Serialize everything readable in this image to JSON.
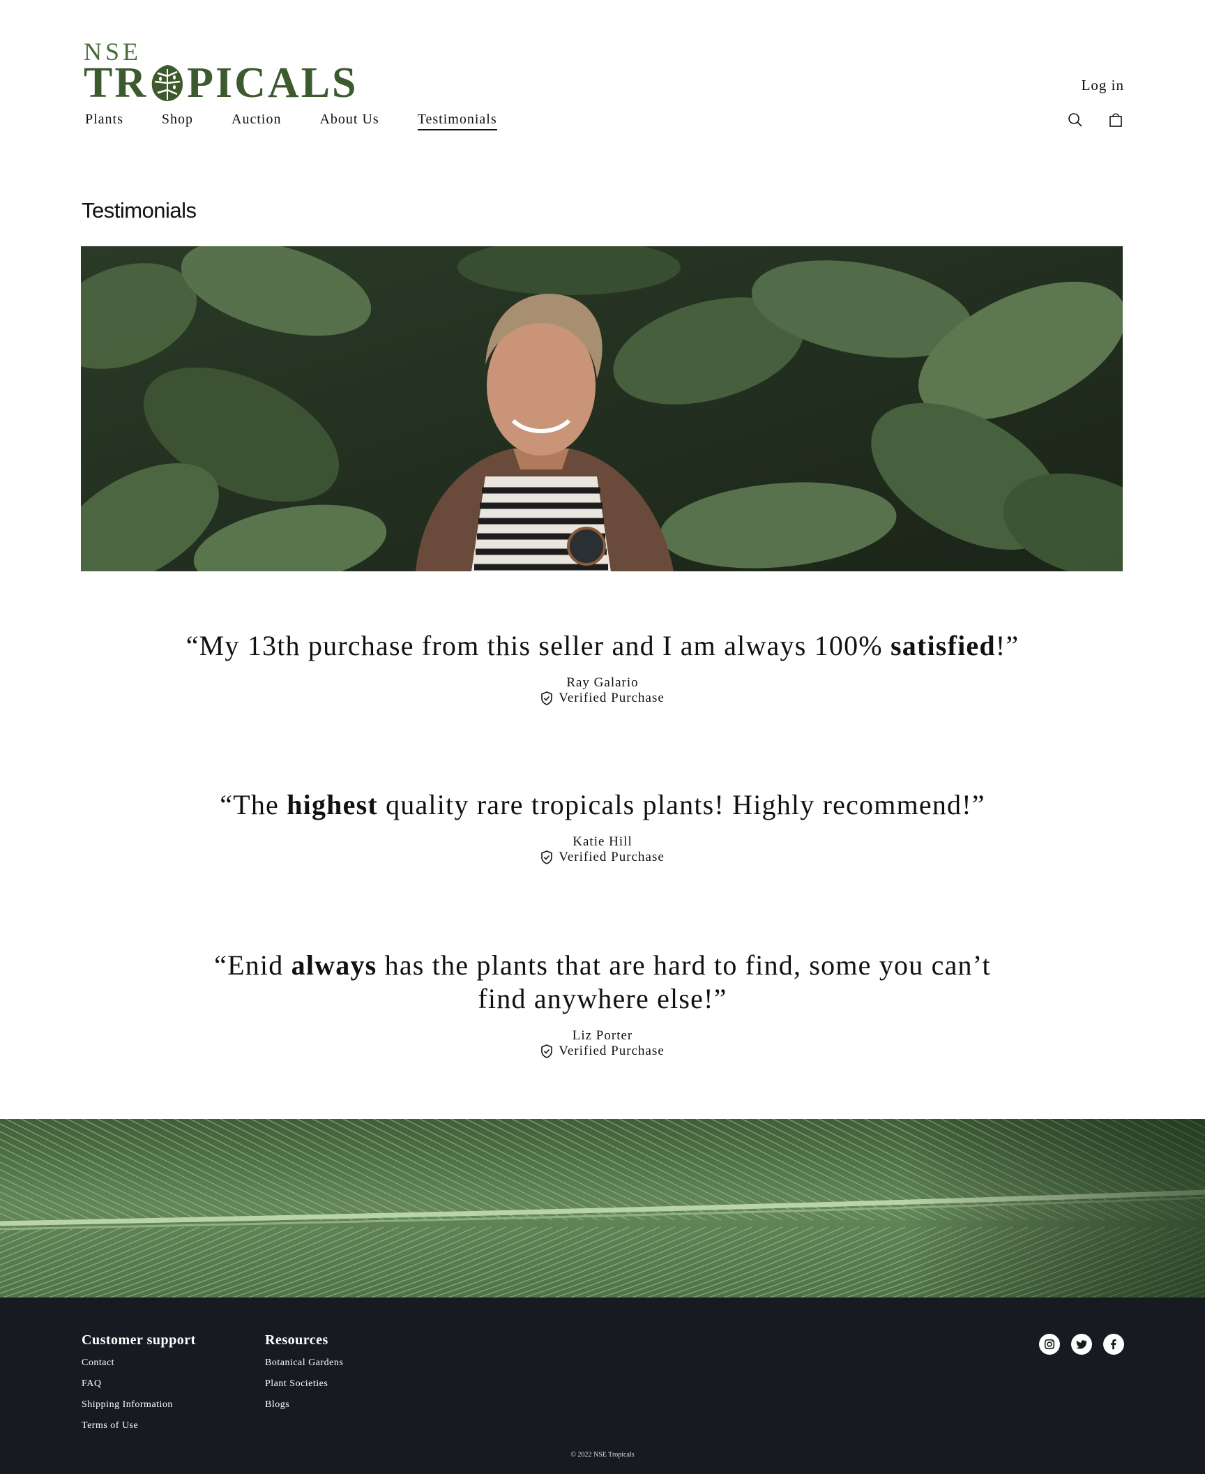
{
  "brand": {
    "line1": "NSE",
    "line2_left": "TR",
    "line2_right": "PICALS"
  },
  "header": {
    "login_label": "Log in",
    "nav": [
      {
        "label": "Plants"
      },
      {
        "label": "Shop"
      },
      {
        "label": "Auction"
      },
      {
        "label": "About Us"
      },
      {
        "label": "Testimonials",
        "active": true
      }
    ],
    "icons": [
      "search-icon",
      "bag-icon"
    ]
  },
  "page": {
    "title": "Testimonials"
  },
  "testimonials": [
    {
      "pre": "“My 13th purchase from this seller and I am always 100% ",
      "bold": "satisfied",
      "post": "!”",
      "author": "Ray Galario",
      "badge": "Verified Purchase"
    },
    {
      "pre": "“The ",
      "bold": "highest",
      "post": " quality rare tropicals plants! Highly recommend!”",
      "author": "Katie Hill",
      "badge": "Verified Purchase"
    },
    {
      "pre": "“Enid ",
      "bold": "always",
      "post": " has the plants that are hard to find, some you can’t find anywhere else!”",
      "author": "Liz Porter",
      "badge": "Verified Purchase"
    }
  ],
  "footer": {
    "customer_support": {
      "heading": "Customer support",
      "links": [
        "Contact",
        "FAQ",
        "Shipping Information",
        "Terms of Use"
      ]
    },
    "resources": {
      "heading": "Resources",
      "links": [
        "Botanical Gardens",
        "Plant Societies",
        "Blogs"
      ]
    },
    "social": [
      "instagram-icon",
      "twitter-icon",
      "facebook-icon"
    ],
    "copyright": "© 2022 NSE Tropicals"
  },
  "colors": {
    "brand_green": "#3d5a2e",
    "footer_bg": "#171a21"
  }
}
